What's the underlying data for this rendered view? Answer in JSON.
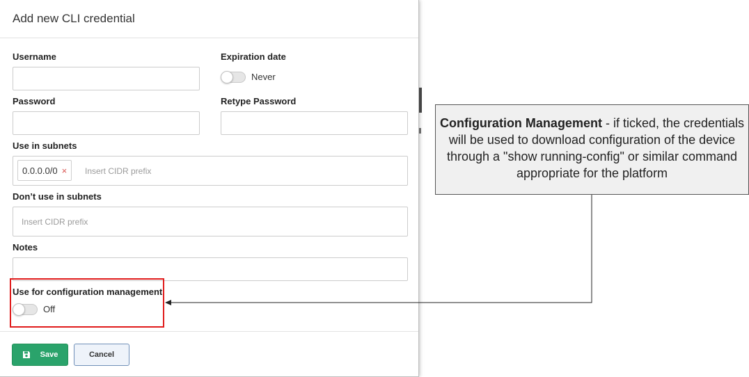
{
  "modal": {
    "title": "Add new CLI credential",
    "fields": {
      "username_label": "Username",
      "expiration_label": "Expiration date",
      "expiration_toggle_text": "Never",
      "password_label": "Password",
      "retype_password_label": "Retype Password",
      "use_subnets_label": "Use in subnets",
      "use_subnets_chip": "0.0.0.0/0",
      "use_subnets_chip_remove": "×",
      "use_subnets_placeholder": "Insert CIDR prefix",
      "dont_use_subnets_label": "Don’t use in subnets",
      "dont_use_subnets_placeholder": "Insert CIDR prefix",
      "notes_label": "Notes",
      "config_mgmt_label": "Use for configuration management",
      "config_mgmt_toggle_text": "Off"
    },
    "footer": {
      "save_label": "Save",
      "cancel_label": "Cancel"
    }
  },
  "callout": {
    "title": "Configuration Management",
    "text": " - if ticked, the credentials will be used to download configuration of the device through a \"show running-config\" or similar command appropriate for the platform"
  },
  "colors": {
    "save_button": "#2aa36b",
    "highlight_border": "#e01b1b",
    "remove_chip_x": "#d9534f",
    "callout_background": "#f0f0f0"
  }
}
